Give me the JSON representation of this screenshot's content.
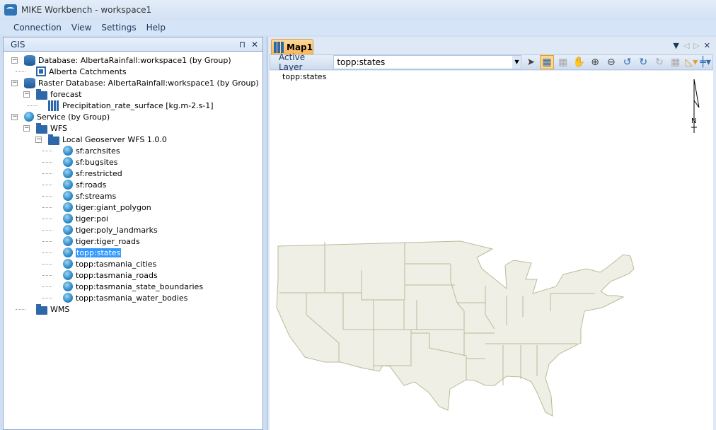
{
  "window": {
    "title": "MIKE Workbench - workspace1"
  },
  "menu": [
    "Connection",
    "View",
    "Settings",
    "Help"
  ],
  "gis": {
    "title": "GIS",
    "pin": "⊓",
    "close": "✕",
    "tree": [
      {
        "label": "Database: AlbertaRainfall:workspace1 (by Group)",
        "level": 0,
        "icon": "database-icon",
        "expanded": true
      },
      {
        "label": "Alberta Catchments",
        "level": 1,
        "icon": "layer-icon"
      },
      {
        "label": "Raster Database: AlbertaRainfall:workspace1 (by Group)",
        "level": 0,
        "icon": "raster-database-icon",
        "expanded": true
      },
      {
        "label": "forecast",
        "level": 1,
        "icon": "folder-icon",
        "expanded": true
      },
      {
        "label": "Precipitation_rate_surface [kg.m-2.s-1]",
        "level": 2,
        "icon": "raster-icon"
      },
      {
        "label": "Service (by Group)",
        "level": 0,
        "icon": "globe-icon",
        "expanded": true
      },
      {
        "label": "WFS",
        "level": 1,
        "icon": "folder-icon",
        "expanded": true
      },
      {
        "label": "Local Geoserver WFS 1.0.0",
        "level": 2,
        "icon": "folder-icon",
        "expanded": true
      },
      {
        "label": "sf:archsites",
        "level": 3,
        "icon": "globe-icon"
      },
      {
        "label": "sf:bugsites",
        "level": 3,
        "icon": "globe-icon"
      },
      {
        "label": "sf:restricted",
        "level": 3,
        "icon": "globe-icon"
      },
      {
        "label": "sf:roads",
        "level": 3,
        "icon": "globe-icon"
      },
      {
        "label": "sf:streams",
        "level": 3,
        "icon": "globe-icon"
      },
      {
        "label": "tiger:giant_polygon",
        "level": 3,
        "icon": "globe-icon"
      },
      {
        "label": "tiger:poi",
        "level": 3,
        "icon": "globe-icon"
      },
      {
        "label": "tiger:poly_landmarks",
        "level": 3,
        "icon": "globe-icon"
      },
      {
        "label": "tiger:tiger_roads",
        "level": 3,
        "icon": "globe-icon"
      },
      {
        "label": "topp:states",
        "level": 3,
        "icon": "globe-icon",
        "selected": true
      },
      {
        "label": "topp:tasmania_cities",
        "level": 3,
        "icon": "globe-icon"
      },
      {
        "label": "topp:tasmania_roads",
        "level": 3,
        "icon": "globe-icon"
      },
      {
        "label": "topp:tasmania_state_boundaries",
        "level": 3,
        "icon": "globe-icon"
      },
      {
        "label": "topp:tasmania_water_bodies",
        "level": 3,
        "icon": "globe-icon"
      },
      {
        "label": "WMS",
        "level": 1,
        "icon": "folder-icon"
      }
    ]
  },
  "map": {
    "tab": "Map1",
    "active_layer_label": "Active Layer",
    "active_layer_value": "topp:states",
    "layer_caption": "topp:states",
    "north_label": "N",
    "colors": {
      "land": "#f0efe6",
      "border": "#b5bd95",
      "selection": "#3399ff"
    }
  }
}
